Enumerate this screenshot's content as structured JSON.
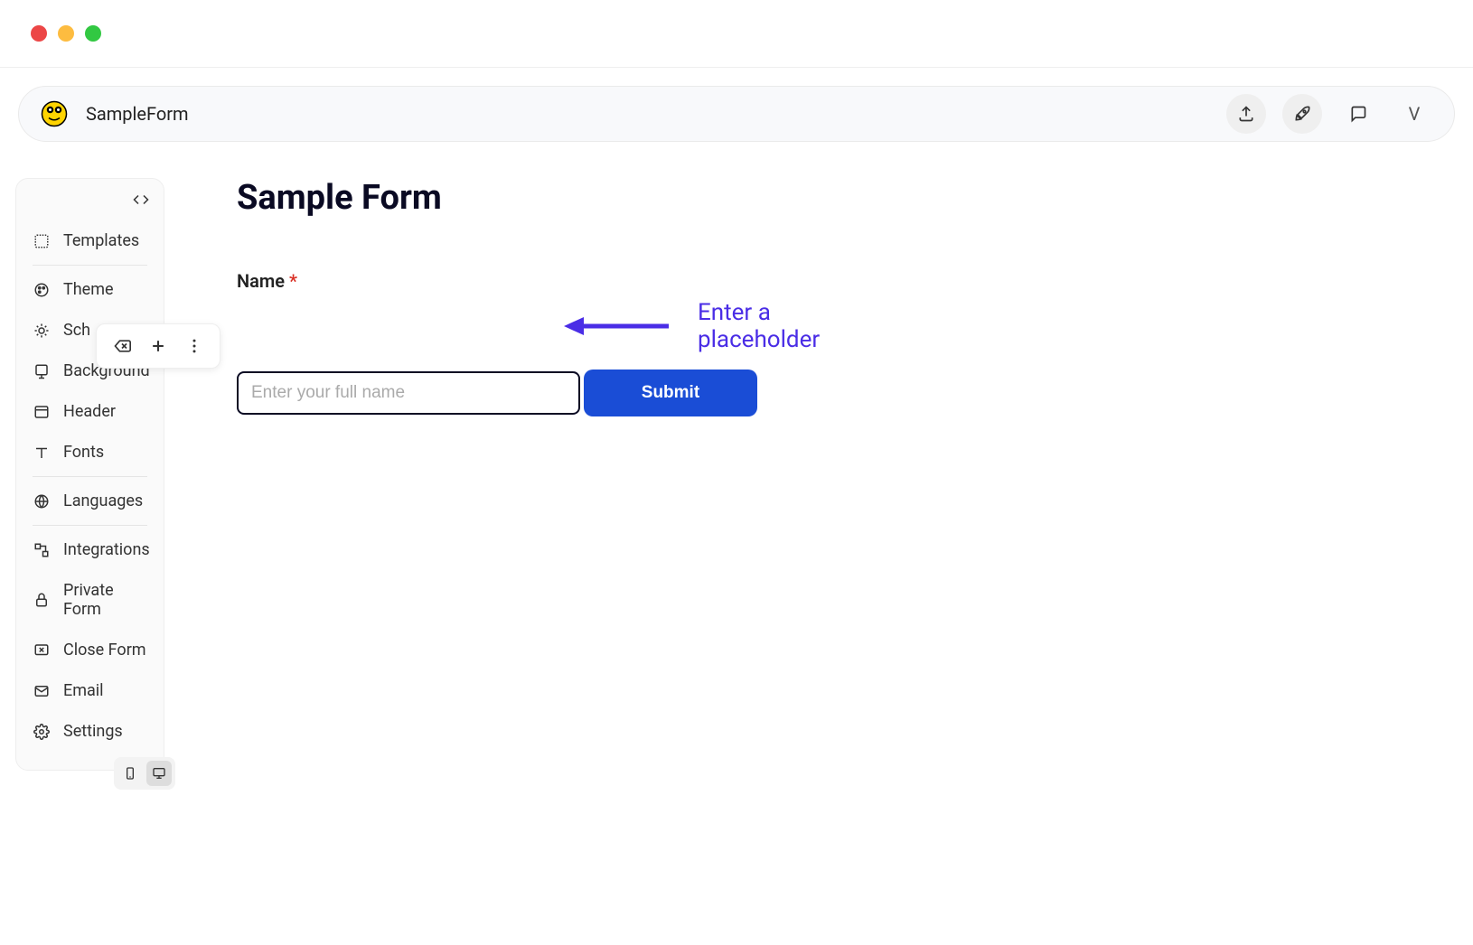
{
  "header": {
    "title": "SampleForm",
    "avatar_letter": "V"
  },
  "sidebar": {
    "items": [
      {
        "label": "Templates",
        "icon": "template"
      },
      {
        "label": "Theme",
        "icon": "palette"
      },
      {
        "label": "Sch",
        "icon": "sun"
      },
      {
        "label": "Background",
        "icon": "background"
      },
      {
        "label": "Header",
        "icon": "header"
      },
      {
        "label": "Fonts",
        "icon": "fonts"
      },
      {
        "label": "Languages",
        "icon": "globe"
      },
      {
        "label": "Integrations",
        "icon": "integrations"
      },
      {
        "label": "Private Form",
        "icon": "lock"
      },
      {
        "label": "Close Form",
        "icon": "closeform"
      },
      {
        "label": "Email",
        "icon": "mail"
      },
      {
        "label": "Settings",
        "icon": "gear"
      }
    ]
  },
  "form": {
    "title": "Sample Form",
    "field_label": "Name",
    "required_mark": "*",
    "name_placeholder": "Enter your full name",
    "submit_label": "Submit"
  },
  "annotation": {
    "text": "Enter a placeholder"
  }
}
